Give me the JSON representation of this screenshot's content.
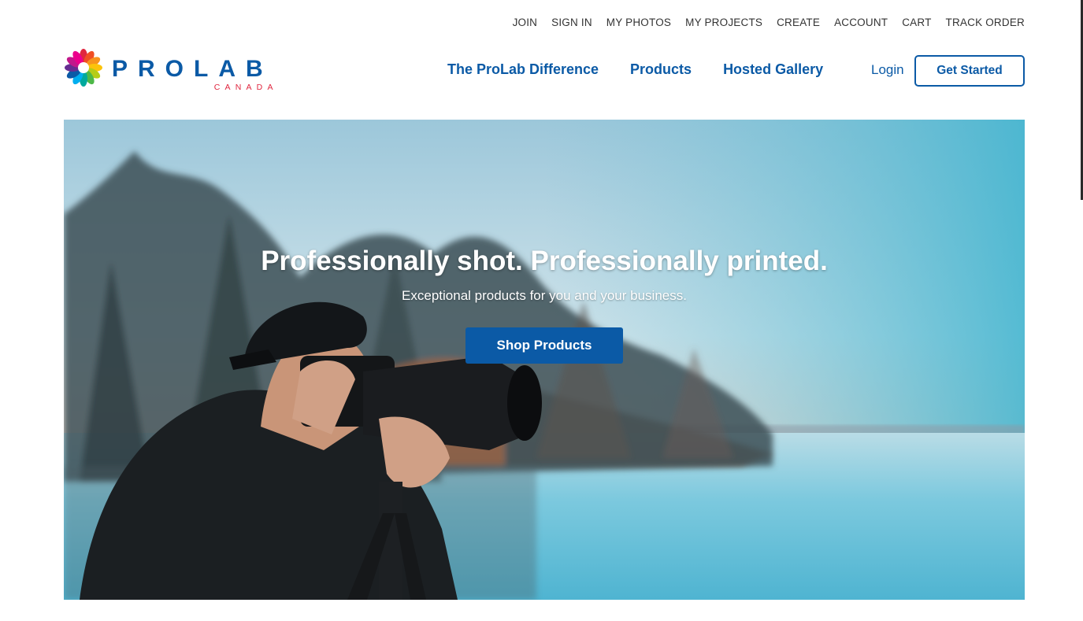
{
  "top_links": [
    "JOIN",
    "SIGN IN",
    "MY PHOTOS",
    "MY PROJECTS",
    "CREATE",
    "ACCOUNT",
    "CART",
    "TRACK ORDER"
  ],
  "logo": {
    "word": "PROLAB",
    "sub": "CANADA"
  },
  "main_nav": [
    "The ProLab Difference",
    "Products",
    "Hosted Gallery"
  ],
  "auth": {
    "login": "Login",
    "get_started": "Get Started"
  },
  "hero": {
    "title": "Professionally shot. Professionally printed.",
    "subtitle": "Exceptional products for you and your business.",
    "cta": "Shop Products",
    "image": "photographer-with-camera-by-water"
  },
  "colors": {
    "brand_blue": "#0b5aa6",
    "logo_red": "#e0263f",
    "text_dark": "#333333"
  }
}
